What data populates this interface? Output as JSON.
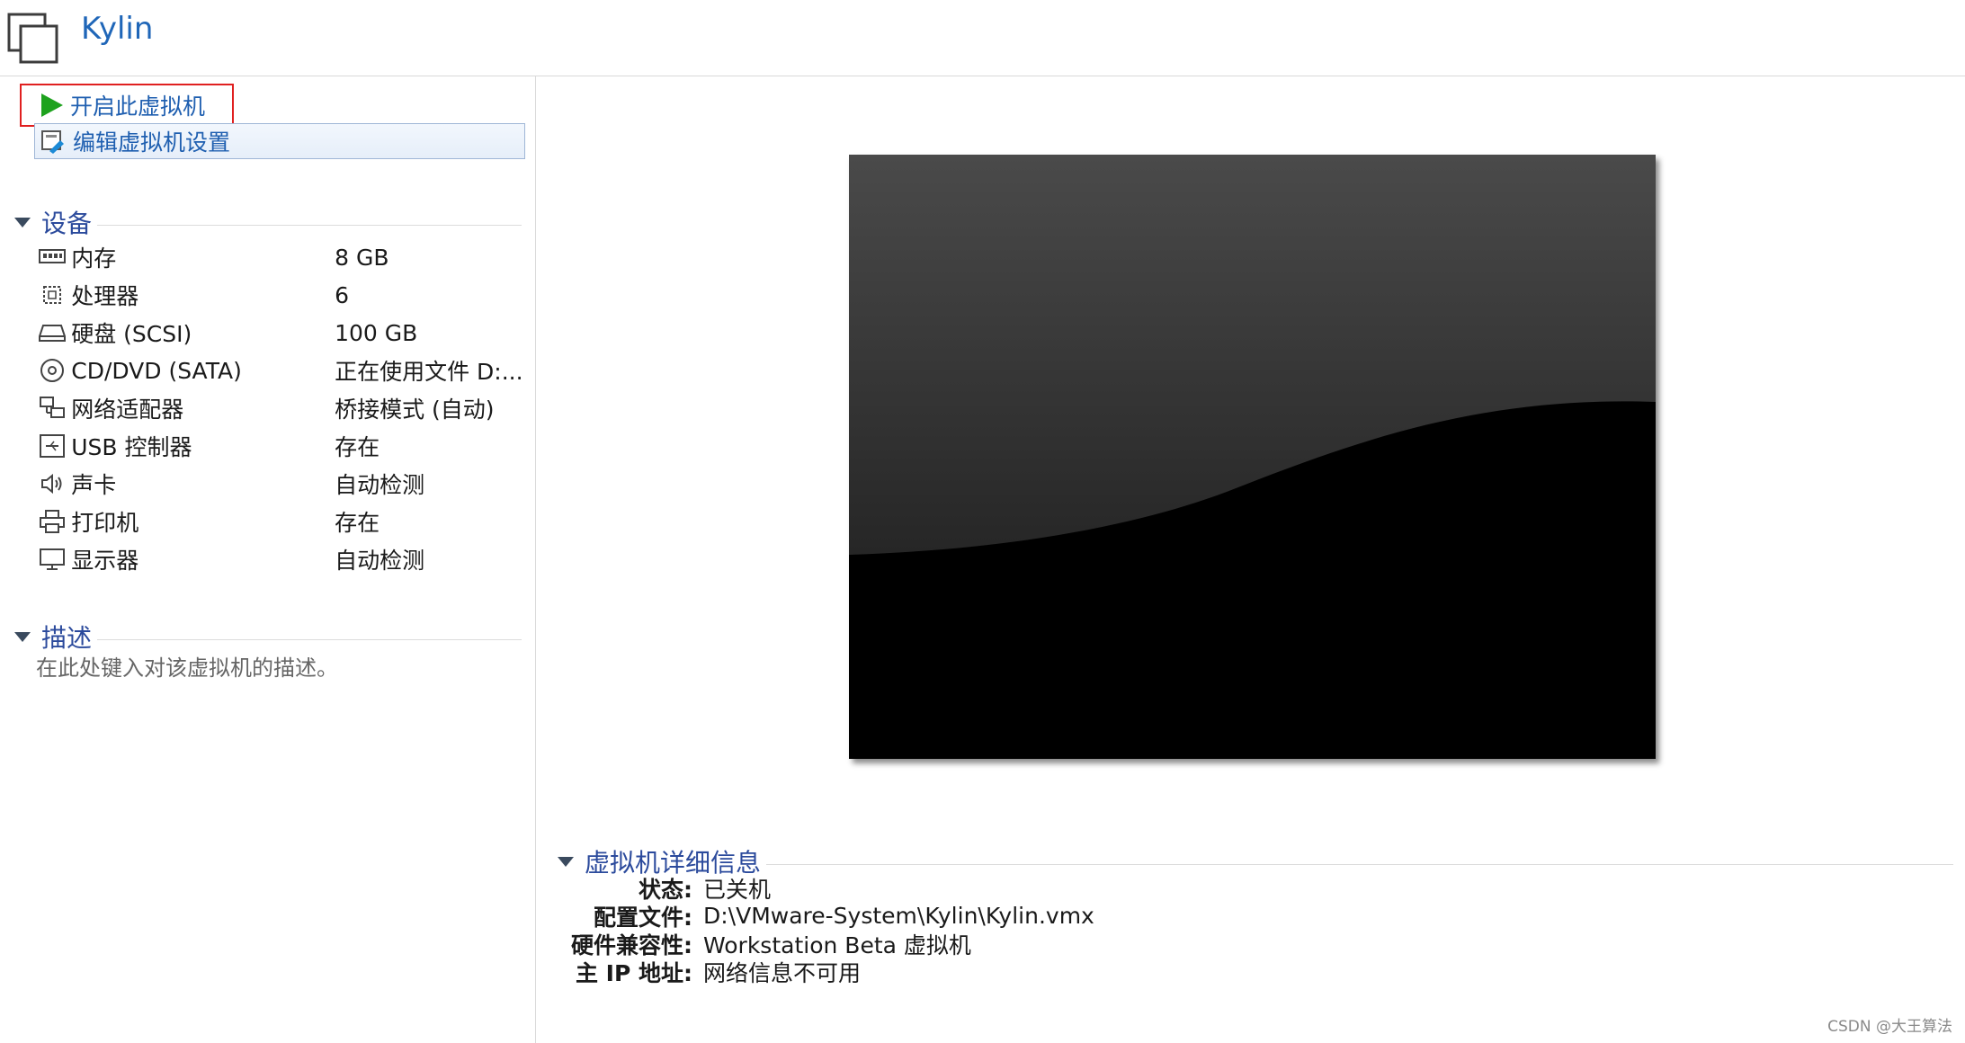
{
  "header": {
    "title": "Kylin",
    "icon": "vm-window-icon"
  },
  "actions": {
    "start_label": "开启此虚拟机",
    "edit_label": "编辑虚拟机设置"
  },
  "devices": {
    "title": "设备",
    "items": [
      {
        "icon": "memory-icon",
        "name": "内存",
        "value": "8 GB"
      },
      {
        "icon": "processor-icon",
        "name": "处理器",
        "value": "6"
      },
      {
        "icon": "harddisk-icon",
        "name": "硬盘 (SCSI)",
        "value": "100 GB"
      },
      {
        "icon": "cd-dvd-icon",
        "name": "CD/DVD (SATA)",
        "value": "正在使用文件 D:..."
      },
      {
        "icon": "network-icon",
        "name": "网络适配器",
        "value": "桥接模式 (自动)"
      },
      {
        "icon": "usb-icon",
        "name": "USB 控制器",
        "value": "存在"
      },
      {
        "icon": "sound-icon",
        "name": "声卡",
        "value": "自动检测"
      },
      {
        "icon": "printer-icon",
        "name": "打印机",
        "value": "存在"
      },
      {
        "icon": "display-icon",
        "name": "显示器",
        "value": "自动检测"
      }
    ]
  },
  "description": {
    "title": "描述",
    "placeholder": "在此处键入对该虚拟机的描述。"
  },
  "details": {
    "title": "虚拟机详细信息",
    "rows": [
      {
        "label": "状态:",
        "value": "已关机"
      },
      {
        "label": "配置文件:",
        "value": "D:\\VMware-System\\Kylin\\Kylin.vmx"
      },
      {
        "label": "硬件兼容性:",
        "value": "Workstation Beta 虚拟机"
      },
      {
        "label": "主 IP 地址:",
        "value": "网络信息不可用"
      }
    ]
  },
  "watermark": "CSDN @大王算法",
  "colors": {
    "accent": "#1f66b8",
    "section": "#2b4a9c",
    "play": "#1ea21e",
    "highlight_border": "#e02020"
  }
}
